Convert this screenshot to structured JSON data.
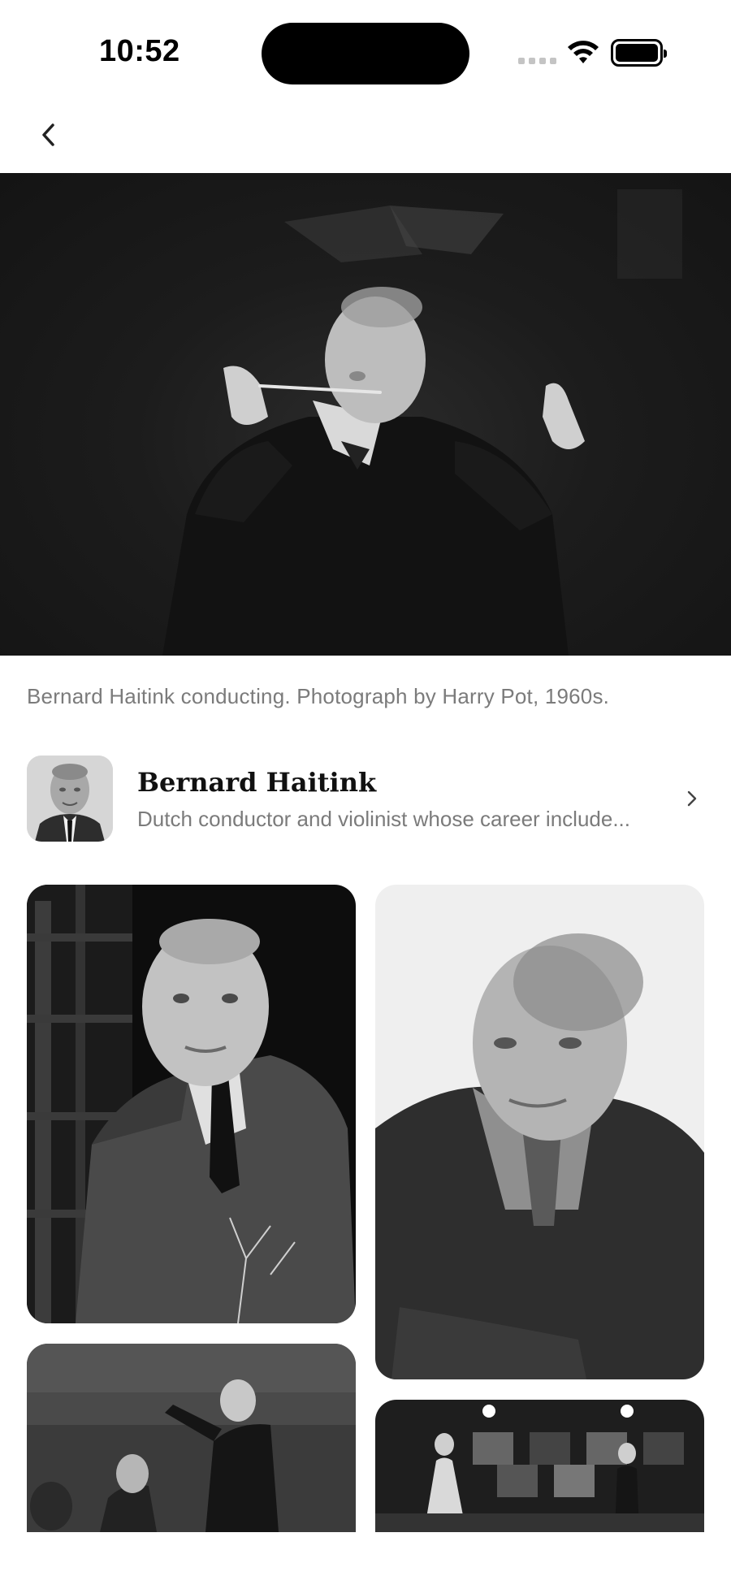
{
  "status_bar": {
    "time": "10:52"
  },
  "nav": {
    "back_icon": "chevron-left-icon"
  },
  "hero": {
    "caption": "Bernard Haitink conducting. Photograph by Harry Pot, 1960s."
  },
  "person": {
    "name": "Bernard Haitink",
    "description": "Dutch conductor and violinist whose career include...",
    "chevron_icon": "chevron-right-icon"
  },
  "gallery": {
    "photos": [
      {
        "name": "young-portrait-photo"
      },
      {
        "name": "older-portrait-photo"
      },
      {
        "name": "orchestra-conducting-photo"
      },
      {
        "name": "concert-stage-photo"
      }
    ]
  }
}
